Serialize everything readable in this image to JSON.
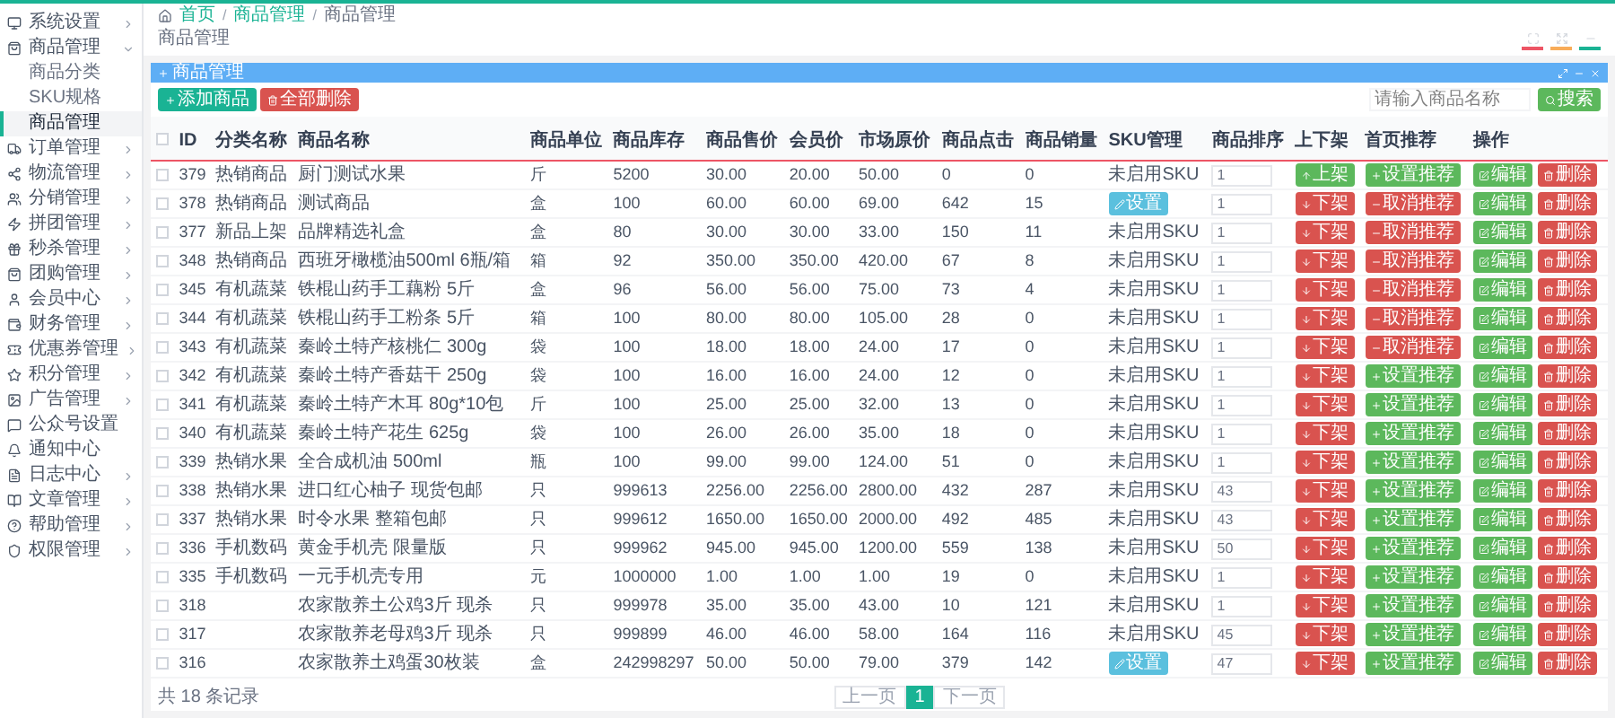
{
  "sidebar": {
    "items": [
      {
        "label": "系统设置",
        "expanded": false
      },
      {
        "label": "商品管理",
        "expanded": true,
        "children": [
          {
            "label": "商品分类",
            "selected": false
          },
          {
            "label": "SKU规格",
            "selected": false
          },
          {
            "label": "商品管理",
            "selected": true
          }
        ]
      },
      {
        "label": "订单管理",
        "expanded": false
      },
      {
        "label": "物流管理",
        "expanded": false
      },
      {
        "label": "分销管理",
        "expanded": false
      },
      {
        "label": "拼团管理",
        "expanded": false
      },
      {
        "label": "秒杀管理",
        "expanded": false
      },
      {
        "label": "团购管理",
        "expanded": false
      },
      {
        "label": "会员中心",
        "expanded": false
      },
      {
        "label": "财务管理",
        "expanded": false
      },
      {
        "label": "优惠券管理",
        "expanded": false
      },
      {
        "label": "积分管理",
        "expanded": false
      },
      {
        "label": "广告管理",
        "expanded": false
      },
      {
        "label": "公众号设置"
      },
      {
        "label": "通知中心"
      },
      {
        "label": "日志中心",
        "expanded": false
      },
      {
        "label": "文章管理",
        "expanded": false
      },
      {
        "label": "帮助管理",
        "expanded": false
      },
      {
        "label": "权限管理",
        "expanded": false
      }
    ]
  },
  "breadcrumb": {
    "items": [
      "首页",
      "商品管理",
      "商品管理"
    ],
    "separators": [
      "/",
      "/"
    ]
  },
  "page_title": "商品管理",
  "panel": {
    "title": "商品管理",
    "add_button": "添加商品",
    "delete_all_button": "全部删除",
    "search": {
      "placeholder": "请输入商品名称"
    },
    "search_button": "搜索"
  },
  "table": {
    "header_checked": false,
    "columns": [
      "ID",
      "分类名称",
      "商品名称",
      "商品单位",
      "商品库存",
      "商品售价",
      "会员价",
      "市场原价",
      "商品点击",
      "商品销量",
      "SKU管理",
      "商品排序",
      "上下架",
      "首页推荐",
      "操作"
    ],
    "rows": [
      {
        "checked": false,
        "id": "379",
        "cat": "热销商品",
        "c": [
          "厨门测试水果",
          "斤",
          "5200",
          "30.00",
          "20.00",
          "50.00",
          "0",
          "0"
        ],
        "sku": {
          "kind": "text",
          "label": "未启用SKU"
        },
        "sort": "1",
        "shelf": {
          "kind": "on",
          "label": "上架"
        },
        "rec": {
          "kind": "set",
          "label": "设置推荐"
        },
        "edit": "编辑",
        "del": "删除"
      },
      {
        "checked": false,
        "id": "378",
        "cat": "热销商品",
        "c": [
          "测试商品",
          "盒",
          "100",
          "60.00",
          "60.00",
          "69.00",
          "642",
          "15"
        ],
        "sku": {
          "kind": "button",
          "label": "设置"
        },
        "sort": "1",
        "shelf": {
          "kind": "off",
          "label": "下架"
        },
        "rec": {
          "kind": "cancel",
          "label": "取消推荐"
        },
        "edit": "编辑",
        "del": "删除"
      },
      {
        "checked": false,
        "id": "377",
        "cat": "新品上架",
        "c": [
          "品牌精选礼盒",
          "盒",
          "80",
          "30.00",
          "30.00",
          "33.00",
          "150",
          "11"
        ],
        "sku": {
          "kind": "text",
          "label": "未启用SKU"
        },
        "sort": "1",
        "shelf": {
          "kind": "off",
          "label": "下架"
        },
        "rec": {
          "kind": "cancel",
          "label": "取消推荐"
        },
        "edit": "编辑",
        "del": "删除"
      },
      {
        "checked": false,
        "id": "348",
        "cat": "热销商品",
        "c": [
          "西班牙橄榄油500ml 6瓶/箱",
          "箱",
          "92",
          "350.00",
          "350.00",
          "420.00",
          "67",
          "8"
        ],
        "sku": {
          "kind": "text",
          "label": "未启用SKU"
        },
        "sort": "1",
        "shelf": {
          "kind": "off",
          "label": "下架"
        },
        "rec": {
          "kind": "cancel",
          "label": "取消推荐"
        },
        "edit": "编辑",
        "del": "删除"
      },
      {
        "checked": false,
        "id": "345",
        "cat": "有机蔬菜",
        "c": [
          "铁棍山药手工藕粉 5斤",
          "盒",
          "96",
          "56.00",
          "56.00",
          "75.00",
          "73",
          "4"
        ],
        "sku": {
          "kind": "text",
          "label": "未启用SKU"
        },
        "sort": "1",
        "shelf": {
          "kind": "off",
          "label": "下架"
        },
        "rec": {
          "kind": "cancel",
          "label": "取消推荐"
        },
        "edit": "编辑",
        "del": "删除"
      },
      {
        "checked": false,
        "id": "344",
        "cat": "有机蔬菜",
        "c": [
          "铁棍山药手工粉条 5斤",
          "箱",
          "100",
          "80.00",
          "80.00",
          "105.00",
          "28",
          "0"
        ],
        "sku": {
          "kind": "text",
          "label": "未启用SKU"
        },
        "sort": "1",
        "shelf": {
          "kind": "off",
          "label": "下架"
        },
        "rec": {
          "kind": "cancel",
          "label": "取消推荐"
        },
        "edit": "编辑",
        "del": "删除"
      },
      {
        "checked": false,
        "id": "343",
        "cat": "有机蔬菜",
        "c": [
          "秦岭土特产核桃仁 300g",
          "袋",
          "100",
          "18.00",
          "18.00",
          "24.00",
          "17",
          "0"
        ],
        "sku": {
          "kind": "text",
          "label": "未启用SKU"
        },
        "sort": "1",
        "shelf": {
          "kind": "off",
          "label": "下架"
        },
        "rec": {
          "kind": "cancel",
          "label": "取消推荐"
        },
        "edit": "编辑",
        "del": "删除"
      },
      {
        "checked": false,
        "id": "342",
        "cat": "有机蔬菜",
        "c": [
          "秦岭土特产香菇干 250g",
          "袋",
          "100",
          "16.00",
          "16.00",
          "24.00",
          "12",
          "0"
        ],
        "sku": {
          "kind": "text",
          "label": "未启用SKU"
        },
        "sort": "1",
        "shelf": {
          "kind": "off",
          "label": "下架"
        },
        "rec": {
          "kind": "set",
          "label": "设置推荐"
        },
        "edit": "编辑",
        "del": "删除"
      },
      {
        "checked": false,
        "id": "341",
        "cat": "有机蔬菜",
        "c": [
          "秦岭土特产木耳 80g*10包",
          "斤",
          "100",
          "25.00",
          "25.00",
          "32.00",
          "13",
          "0"
        ],
        "sku": {
          "kind": "text",
          "label": "未启用SKU"
        },
        "sort": "1",
        "shelf": {
          "kind": "off",
          "label": "下架"
        },
        "rec": {
          "kind": "set",
          "label": "设置推荐"
        },
        "edit": "编辑",
        "del": "删除"
      },
      {
        "checked": false,
        "id": "340",
        "cat": "有机蔬菜",
        "c": [
          "秦岭土特产花生 625g",
          "袋",
          "100",
          "26.00",
          "26.00",
          "35.00",
          "18",
          "0"
        ],
        "sku": {
          "kind": "text",
          "label": "未启用SKU"
        },
        "sort": "1",
        "shelf": {
          "kind": "off",
          "label": "下架"
        },
        "rec": {
          "kind": "set",
          "label": "设置推荐"
        },
        "edit": "编辑",
        "del": "删除"
      },
      {
        "checked": false,
        "id": "339",
        "cat": "热销水果",
        "c": [
          "全合成机油 500ml",
          "瓶",
          "100",
          "99.00",
          "99.00",
          "124.00",
          "51",
          "0"
        ],
        "sku": {
          "kind": "text",
          "label": "未启用SKU"
        },
        "sort": "1",
        "shelf": {
          "kind": "off",
          "label": "下架"
        },
        "rec": {
          "kind": "set",
          "label": "设置推荐"
        },
        "edit": "编辑",
        "del": "删除"
      },
      {
        "checked": false,
        "id": "338",
        "cat": "热销水果",
        "c": [
          "进口红心柚子 现货包邮",
          "只",
          "999613",
          "2256.00",
          "2256.00",
          "2800.00",
          "432",
          "287"
        ],
        "sku": {
          "kind": "text",
          "label": "未启用SKU"
        },
        "sort": "43",
        "shelf": {
          "kind": "off",
          "label": "下架"
        },
        "rec": {
          "kind": "set",
          "label": "设置推荐"
        },
        "edit": "编辑",
        "del": "删除"
      },
      {
        "checked": false,
        "id": "337",
        "cat": "热销水果",
        "c": [
          "时令水果 整箱包邮",
          "只",
          "999612",
          "1650.00",
          "1650.00",
          "2000.00",
          "492",
          "485"
        ],
        "sku": {
          "kind": "text",
          "label": "未启用SKU"
        },
        "sort": "43",
        "shelf": {
          "kind": "off",
          "label": "下架"
        },
        "rec": {
          "kind": "set",
          "label": "设置推荐"
        },
        "edit": "编辑",
        "del": "删除"
      },
      {
        "checked": false,
        "id": "336",
        "cat": "手机数码",
        "c": [
          "黄金手机壳 限量版",
          "只",
          "999962",
          "945.00",
          "945.00",
          "1200.00",
          "559",
          "138"
        ],
        "sku": {
          "kind": "text",
          "label": "未启用SKU"
        },
        "sort": "50",
        "shelf": {
          "kind": "off",
          "label": "下架"
        },
        "rec": {
          "kind": "set",
          "label": "设置推荐"
        },
        "edit": "编辑",
        "del": "删除"
      },
      {
        "checked": false,
        "id": "335",
        "cat": "手机数码",
        "c": [
          "一元手机壳专用",
          "元",
          "1000000",
          "1.00",
          "1.00",
          "1.00",
          "19",
          "0"
        ],
        "sku": {
          "kind": "text",
          "label": "未启用SKU"
        },
        "sort": "1",
        "shelf": {
          "kind": "off",
          "label": "下架"
        },
        "rec": {
          "kind": "set",
          "label": "设置推荐"
        },
        "edit": "编辑",
        "del": "删除"
      },
      {
        "checked": false,
        "id": "318",
        "c": [
          "农家散养土公鸡3斤 现杀",
          "只",
          "999978",
          "35.00",
          "35.00",
          "43.00",
          "10",
          "121"
        ],
        "sku": {
          "kind": "text",
          "label": "未启用SKU"
        },
        "sort": "1",
        "shelf": {
          "kind": "off",
          "label": "下架"
        },
        "rec": {
          "kind": "set",
          "label": "设置推荐"
        },
        "edit": "编辑",
        "del": "删除"
      },
      {
        "checked": false,
        "id": "317",
        "c": [
          "农家散养老母鸡3斤 现杀",
          "只",
          "999899",
          "46.00",
          "46.00",
          "58.00",
          "164",
          "116"
        ],
        "sku": {
          "kind": "text",
          "label": "未启用SKU"
        },
        "sort": "45",
        "shelf": {
          "kind": "off",
          "label": "下架"
        },
        "rec": {
          "kind": "set",
          "label": "设置推荐"
        },
        "edit": "编辑",
        "del": "删除"
      },
      {
        "checked": false,
        "id": "316",
        "c": [
          "农家散养土鸡蛋30枚装",
          "盒",
          "242998297",
          "50.00",
          "50.00",
          "79.00",
          "379",
          "142"
        ],
        "sku": {
          "kind": "button",
          "label": "设置"
        },
        "sort": "47",
        "shelf": {
          "kind": "off",
          "label": "下架"
        },
        "rec": {
          "kind": "set",
          "label": "设置推荐"
        },
        "edit": "编辑",
        "del": "删除"
      }
    ]
  },
  "footer": {
    "count": "共 18 条记录",
    "pagination": [
      {
        "label": "上一页",
        "selected": false
      },
      {
        "label": "1",
        "selected": true
      },
      {
        "label": "下一页",
        "selected": false
      }
    ]
  }
}
